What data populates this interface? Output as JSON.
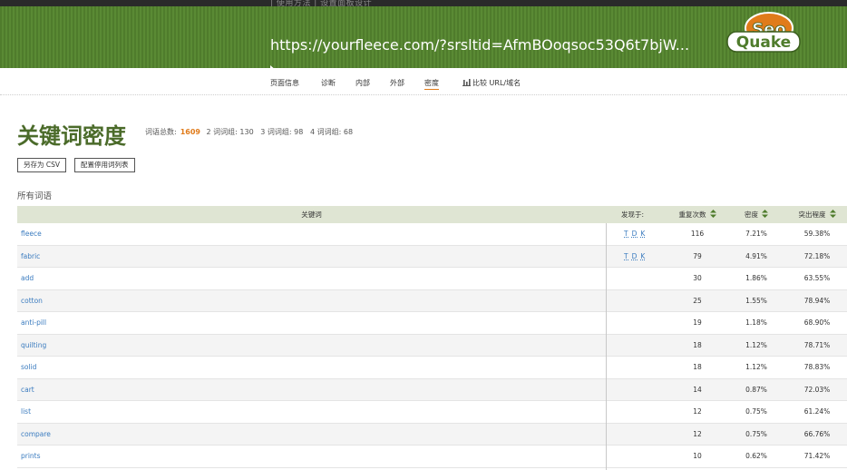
{
  "topstrip": {
    "text": "| 使用方法 | 设置面板设计"
  },
  "header": {
    "url": "https://yourfleece.com/?srsltid=AfmBOoqsoc53Q6t7bjW...",
    "logo_top": "Seo",
    "logo_bottom": "Quake"
  },
  "nav": {
    "items": [
      "页面信息",
      "诊断",
      "内部",
      "外部",
      "密度"
    ],
    "active": "密度",
    "compare": "比较 URL/域名"
  },
  "title": "关键词密度",
  "stats": {
    "total_label": "词语总数:",
    "total_value": "1609",
    "g2": "2 词词组: 130",
    "g3": "3 词词组: 98",
    "g4": "4 词词组: 68"
  },
  "buttons": {
    "save_csv": "另存为 CSV",
    "config_stopwords": "配置停用词列表"
  },
  "section_label": "所有词语",
  "table": {
    "headers": {
      "keyword": "关键词",
      "found": "发现于:",
      "count": "重复次数",
      "density": "密度",
      "prominence": "突出程度"
    },
    "rows": [
      {
        "keyword": "fleece",
        "found": [
          "T",
          "D",
          "K"
        ],
        "count": "116",
        "density": "7.21%",
        "prominence": "59.38%"
      },
      {
        "keyword": "fabric",
        "found": [
          "T",
          "D",
          "K"
        ],
        "count": "79",
        "density": "4.91%",
        "prominence": "72.18%"
      },
      {
        "keyword": "add",
        "found": [],
        "count": "30",
        "density": "1.86%",
        "prominence": "63.55%"
      },
      {
        "keyword": "cotton",
        "found": [],
        "count": "25",
        "density": "1.55%",
        "prominence": "78.94%"
      },
      {
        "keyword": "anti-pill",
        "found": [],
        "count": "19",
        "density": "1.18%",
        "prominence": "68.90%"
      },
      {
        "keyword": "quilting",
        "found": [],
        "count": "18",
        "density": "1.12%",
        "prominence": "78.71%"
      },
      {
        "keyword": "solid",
        "found": [],
        "count": "18",
        "density": "1.12%",
        "prominence": "78.83%"
      },
      {
        "keyword": "cart",
        "found": [],
        "count": "14",
        "density": "0.87%",
        "prominence": "72.03%"
      },
      {
        "keyword": "list",
        "found": [],
        "count": "12",
        "density": "0.75%",
        "prominence": "61.24%"
      },
      {
        "keyword": "compare",
        "found": [],
        "count": "12",
        "density": "0.75%",
        "prominence": "66.76%"
      },
      {
        "keyword": "prints",
        "found": [],
        "count": "10",
        "density": "0.62%",
        "prominence": "71.42%"
      }
    ]
  },
  "colors": {
    "header_green": "#5a8a34",
    "title_green": "#4b6b2a",
    "accent_orange": "#e07b1a",
    "link_blue": "#3a7bbf",
    "table_head": "#dfe5d3"
  }
}
